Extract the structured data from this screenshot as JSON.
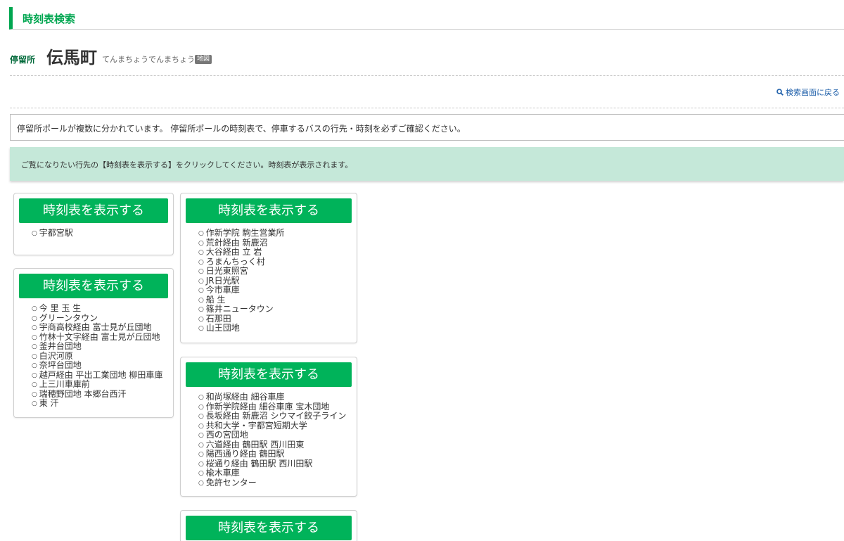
{
  "header": {
    "title": "時刻表検索"
  },
  "stop": {
    "label": "停留所",
    "name": "伝馬町",
    "kana": "てんまちょうでんまちょう",
    "map_label": "地図"
  },
  "back_link": "検索画面に戻る",
  "notice": "停留所ポールが複数に分かれています。 停留所ポールの時刻表で、停車するバスの行先・時刻を必ずご確認ください。",
  "info": "ご覧になりたい行先の【時刻表を表示する】をクリックしてください。時刻表が表示されます。",
  "cards": [
    {
      "button": "時刻表を表示する",
      "destinations": [
        "宇都宮駅"
      ]
    },
    {
      "button": "時刻表を表示する",
      "destinations": [
        "今 里 玉 生",
        "グリーンタウン",
        "宇商高校経由 富士見が丘団地",
        "竹林十文字経由 富士見が丘団地",
        "釜井台団地",
        "白沢河原",
        "奈坪台団地",
        "越戸経由 平出工業団地 柳田車庫",
        "上三川車庫前",
        "瑞穂野団地 本郷台西汗",
        "東 汗"
      ]
    },
    {
      "button": "時刻表を表示する",
      "destinations": [
        "作新学院 駒生営業所",
        "荒針経由 新鹿沼",
        "大谷経由 立 岩",
        "ろまんちっく村",
        "日光東照宮",
        "JR日光駅",
        "今市車庫",
        "船 生",
        "篠井ニュータウン",
        "石那田",
        "山王団地"
      ]
    },
    {
      "button": "時刻表を表示する",
      "destinations": [
        "和尚塚経由 細谷車庫",
        "作新学院経由 細谷車庫 宝木団地",
        "長坂経由 新鹿沼 シウマイ餃子ライン",
        "共和大学・宇都宮短期大学",
        "西の宮団地",
        "六道経由 鶴田駅 西川田東",
        "陽西通り経由 鶴田駅",
        "桜通り経由 鶴田駅 西川田駅",
        "楡木車庫",
        "免許センター"
      ]
    },
    {
      "button": "時刻表を表示する",
      "destinations": []
    }
  ]
}
